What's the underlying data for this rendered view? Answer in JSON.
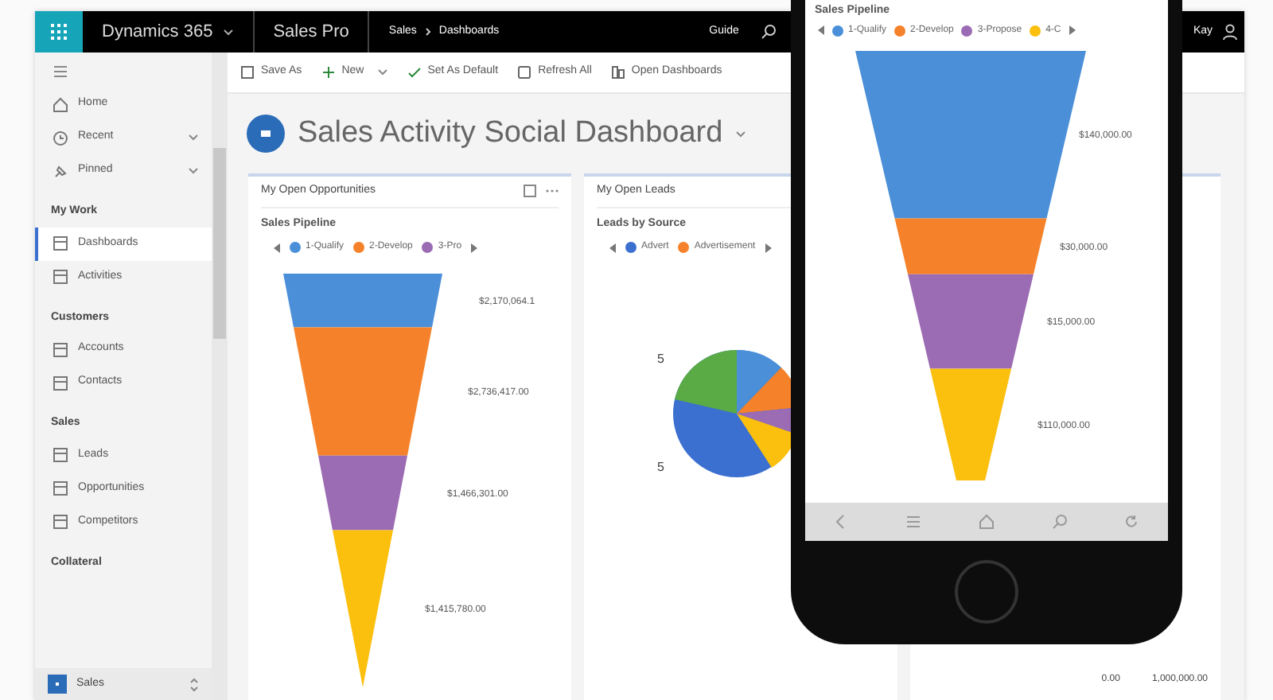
{
  "topbar": {
    "app_name": "Dynamics 365",
    "app_module": "Sales Pro",
    "breadcrumb": [
      "Sales",
      "Dashboards"
    ],
    "guide": "Guide",
    "user": "Kay"
  },
  "commands": [
    {
      "label": "Save As",
      "kind": "plain"
    },
    {
      "label": "New",
      "kind": "dropdown"
    },
    {
      "label": "Set As Default",
      "kind": "plain"
    },
    {
      "label": "Refresh All",
      "kind": "plain"
    },
    {
      "label": "Open Dashboards",
      "kind": "plain"
    }
  ],
  "sidebar": {
    "top_items": [
      {
        "label": "Home",
        "expandable": false
      },
      {
        "label": "Recent",
        "expandable": true
      },
      {
        "label": "Pinned",
        "expandable": true
      }
    ],
    "groups": [
      {
        "title": "My Work",
        "items": [
          {
            "label": "Dashboards",
            "selected": true
          },
          {
            "label": "Activities",
            "selected": false
          }
        ]
      },
      {
        "title": "Customers",
        "items": [
          {
            "label": "Accounts",
            "selected": false
          },
          {
            "label": "Contacts",
            "selected": false
          }
        ]
      },
      {
        "title": "Sales",
        "items": [
          {
            "label": "Leads",
            "selected": false
          },
          {
            "label": "Opportunities",
            "selected": false
          },
          {
            "label": "Competitors",
            "selected": false
          }
        ]
      },
      {
        "title": "Collateral"
      }
    ],
    "area": "Sales"
  },
  "dashboard": {
    "title": "Sales Activity Social Dashboard"
  },
  "panels": [
    {
      "title": "My Open Opportunities",
      "chart_title": "Sales Pipeline",
      "legend": [
        {
          "label": "1-Qualify",
          "color": "#4a8fd8"
        },
        {
          "label": "2-Develop",
          "color": "#f5822a"
        },
        {
          "label": "3-Pro",
          "color": "#9b6bb3"
        }
      ],
      "stages": [
        {
          "value": "$2,170,064.1",
          "color": "#4a8fd8"
        },
        {
          "value": "$2,736,417.00",
          "color": "#f5822a"
        },
        {
          "value": "$1,466,301.00",
          "color": "#9b6bb3"
        },
        {
          "value": "$1,415,780.00",
          "color": "#fbbf0e"
        }
      ]
    },
    {
      "title": "My Open Leads",
      "chart_title": "Leads by Source",
      "legend": [
        {
          "label": "Advert",
          "color": "#3b6fd0"
        },
        {
          "label": "Advertisement",
          "color": "#f5822a"
        }
      ],
      "pie_labels": [
        "5",
        "5"
      ]
    },
    {
      "axis_labels": [
        "0.00",
        "1,000,000.00"
      ]
    }
  ],
  "phone": {
    "chart_title": "Sales Pipeline",
    "legend": [
      {
        "label": "1-Qualify",
        "color": "#4a8fd8"
      },
      {
        "label": "2-Develop",
        "color": "#f5822a"
      },
      {
        "label": "3-Propose",
        "color": "#9b6bb3"
      },
      {
        "label": "4-C",
        "color": "#fbbf0e"
      }
    ],
    "stages": [
      {
        "value": "$140,000.00",
        "color": "#4a8fd8"
      },
      {
        "value": "$30,000.00",
        "color": "#f5822a"
      },
      {
        "value": "$15,000.00",
        "color": "#9b6bb3"
      },
      {
        "value": "$110,000.00",
        "color": "#fbbf0e"
      }
    ]
  }
}
